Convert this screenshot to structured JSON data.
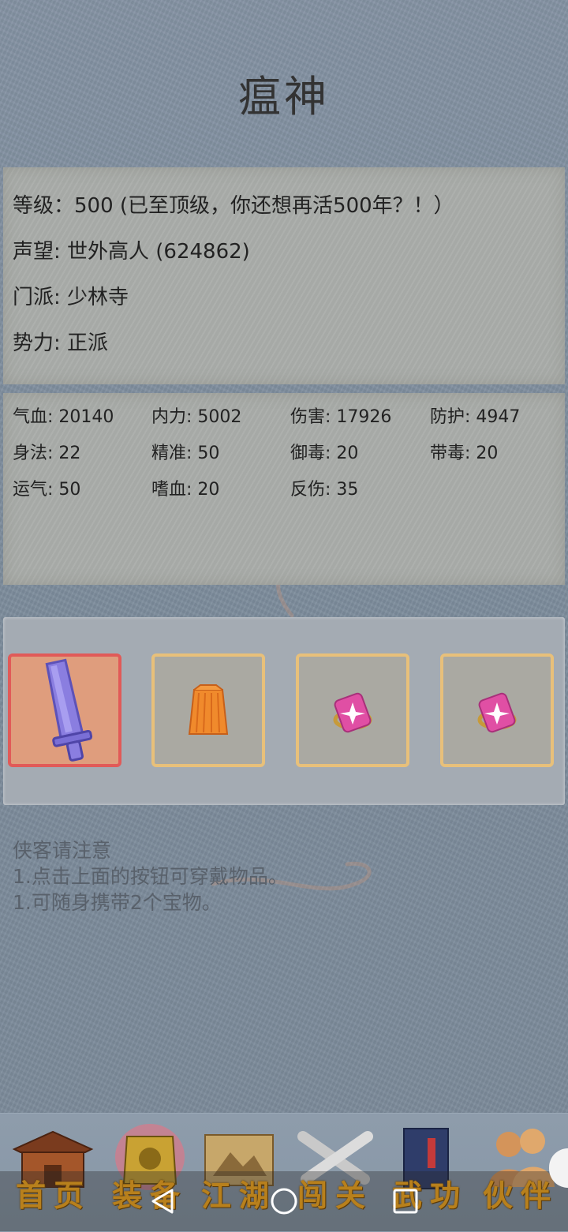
{
  "header": {
    "title": "瘟神"
  },
  "profile": {
    "level": "等级：500 (已至顶级，你还想再活500年？！）",
    "fame": "声望: 世外高人 (624862)",
    "sect": "门派: 少林寺",
    "faction": "势力: 正派"
  },
  "stats": [
    [
      "气血: 20140",
      "内力: 5002",
      "伤害: 17926",
      "防护: 4947"
    ],
    [
      "身法: 22",
      "精准: 50",
      "御毒: 20",
      "带毒: 20"
    ],
    [
      "运气: 50",
      "嗜血: 20",
      "反伤: 35",
      ""
    ]
  ],
  "equipment": [
    {
      "icon": "sword-icon",
      "selected": true
    },
    {
      "icon": "robe-icon",
      "selected": false
    },
    {
      "icon": "treasure-icon",
      "selected": false
    },
    {
      "icon": "treasure-icon",
      "selected": false
    }
  ],
  "notice": {
    "heading": "侠客请注意",
    "line1": "1.点击上面的按钮可穿戴物品。",
    "line2": "1.可随身携带2个宝物。"
  },
  "nav": [
    {
      "label": "首页",
      "icon": "house-icon"
    },
    {
      "label": "装备",
      "icon": "armor-icon"
    },
    {
      "label": "江湖",
      "icon": "scroll-icon"
    },
    {
      "label": "闯关",
      "icon": "swords-icon"
    },
    {
      "label": "武功",
      "icon": "book-icon"
    },
    {
      "label": "伙伴",
      "icon": "partners-icon"
    }
  ],
  "colors": {
    "accent_gold": "#b8801c",
    "slot_border": "#e8c07a",
    "slot_selected_border": "#e15a58"
  }
}
